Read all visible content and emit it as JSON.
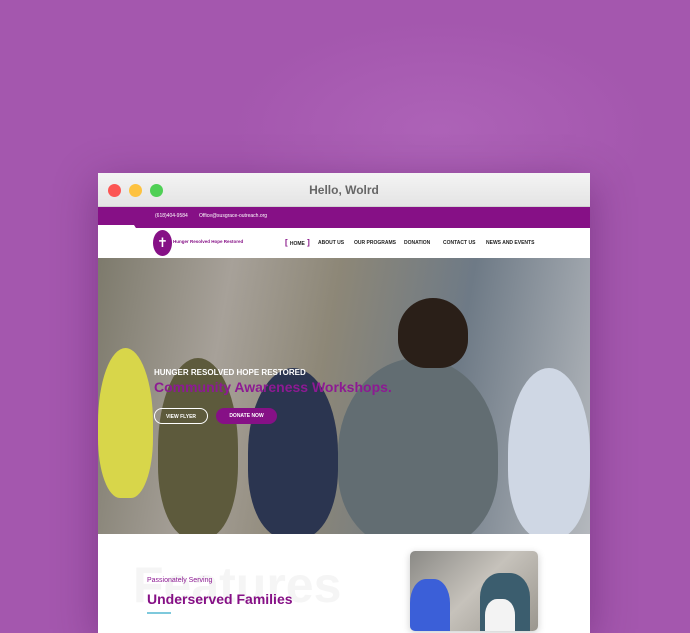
{
  "window": {
    "title": "Hello, Wolrd"
  },
  "topbar": {
    "phone": "(618)404-9584",
    "email": "Office@susgrace-outreach.org"
  },
  "logo": {
    "text": "Hunger Resolved Hope Restored"
  },
  "nav": {
    "items": [
      "HOME",
      "ABOUT US",
      "OUR PROGRAMS",
      "DONATION",
      "CONTACT US",
      "NEWS AND EVENTS"
    ]
  },
  "hero": {
    "subtitle": "HUNGER RESOLVED HOPE RESTORED",
    "title": "Community Awareness Workshops.",
    "view_flyer": "VIEW FLYER",
    "donate": "DONATE NOW"
  },
  "features": {
    "ghost": "Features",
    "eyebrow": "Passionately Serving",
    "heading": "Underserved Families"
  },
  "colors": {
    "brand": "#861086",
    "background": "#a457ae",
    "accent": "#7ec9dc"
  }
}
